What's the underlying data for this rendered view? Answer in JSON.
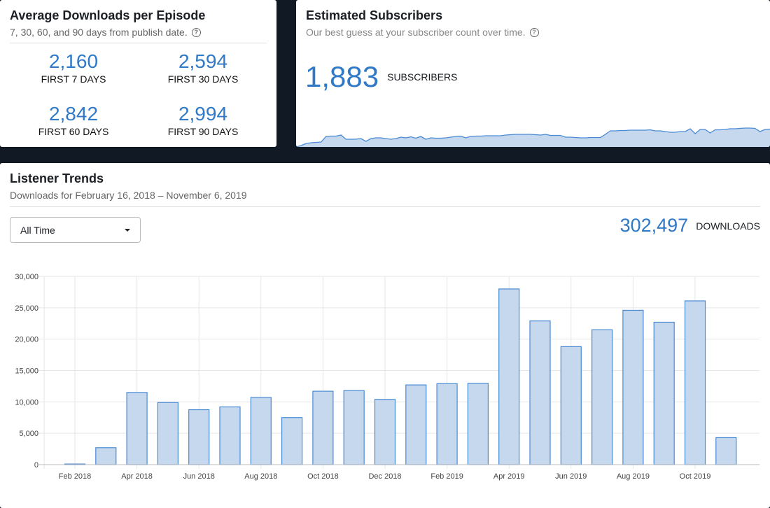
{
  "avg": {
    "title": "Average Downloads per Episode",
    "subtitle": "7, 30, 60, and 90 days from publish date.",
    "stats": [
      {
        "value": "2,160",
        "label": "FIRST 7 DAYS"
      },
      {
        "value": "2,594",
        "label": "FIRST 30 DAYS"
      },
      {
        "value": "2,842",
        "label": "FIRST 60 DAYS"
      },
      {
        "value": "2,994",
        "label": "FIRST 90 DAYS"
      }
    ]
  },
  "subs": {
    "title": "Estimated Subscribers",
    "subtitle": "Our best guess at your subscriber count over time.",
    "value": "1,883",
    "label": "SUBSCRIBERS",
    "sparkline": [
      0,
      2,
      5,
      6,
      6.5,
      7,
      15,
      15.5,
      15.5,
      17,
      11,
      11,
      11.2,
      12,
      8,
      12,
      13,
      13,
      12,
      11,
      12,
      14,
      13,
      14.5,
      12.5,
      15,
      11,
      13,
      12.5,
      12.5,
      13,
      14,
      15,
      15.5,
      13,
      15,
      15.5,
      15.5,
      16,
      16,
      16,
      16,
      17,
      17.5,
      18,
      18,
      18,
      18,
      17.5,
      17,
      18,
      16.5,
      16.5,
      16.5,
      14,
      14,
      13.5,
      13,
      13,
      13.5,
      13.5,
      13.5,
      18,
      23,
      23,
      23.5,
      23.5,
      24,
      24,
      24,
      24,
      24.5,
      23,
      23,
      22,
      21,
      21,
      22,
      22,
      26,
      19,
      25,
      25,
      20,
      24.5,
      24.5,
      25,
      26,
      26,
      26.5,
      27,
      27,
      26.5,
      22,
      25,
      25.5
    ]
  },
  "trends": {
    "title": "Listener Trends",
    "subtitle": "Downloads for February 16, 2018 – November 6, 2019",
    "range_select": "All Time",
    "total": "302,497",
    "total_label": "DOWNLOADS"
  },
  "chart_data": {
    "type": "bar",
    "categories": [
      "Feb 2018",
      "Mar 2018",
      "Apr 2018",
      "May 2018",
      "Jun 2018",
      "Jul 2018",
      "Aug 2018",
      "Sep 2018",
      "Oct 2018",
      "Nov 2018",
      "Dec 2018",
      "Jan 2019",
      "Feb 2019",
      "Mar 2019",
      "Apr 2019",
      "May 2019",
      "Jun 2019",
      "Jul 2019",
      "Aug 2019",
      "Sep 2019",
      "Oct 2019",
      "Nov 2019"
    ],
    "values": [
      100,
      2700,
      11500,
      9900,
      8750,
      9200,
      10700,
      7500,
      11700,
      11800,
      10400,
      12700,
      12900,
      12950,
      28000,
      22900,
      18800,
      21500,
      24600,
      22700,
      26100,
      4300
    ],
    "x_tick_labels": [
      "Feb 2018",
      "Apr 2018",
      "Jun 2018",
      "Aug 2018",
      "Oct 2018",
      "Dec 2018",
      "Feb 2019",
      "Apr 2019",
      "Jun 2019",
      "Aug 2019",
      "Oct 2019"
    ],
    "y_tick_labels": [
      "0",
      "5,000",
      "10,000",
      "15,000",
      "20,000",
      "25,000",
      "30,000"
    ],
    "ylim": [
      0,
      30000
    ],
    "grid": true,
    "colors": {
      "fill": "#c5d8ee",
      "stroke": "#4a8ad4",
      "accent": "#2f79c6"
    }
  }
}
